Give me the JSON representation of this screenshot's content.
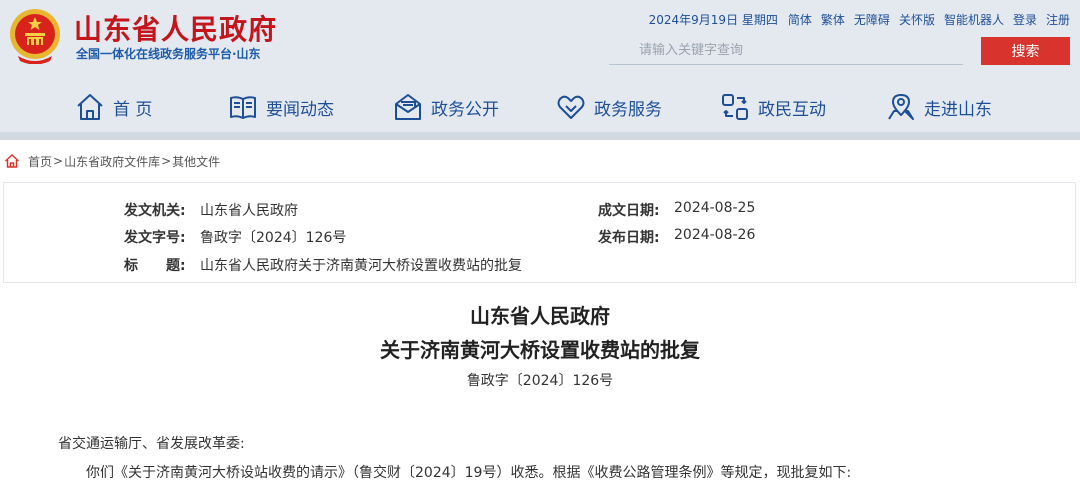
{
  "header": {
    "site_title": "山东省人民政府",
    "site_subtitle": "全国一体化在线政务服务平台·山东",
    "emblem_icon": "national-emblem-icon",
    "toplinks": {
      "date": "2024年9月19日 星期四",
      "simplified": "简体",
      "traditional": "繁体",
      "accessibility": "无障碍",
      "elderly": "关怀版",
      "robot": "智能机器人",
      "login": "登录",
      "register": "注册"
    },
    "search": {
      "placeholder": "请输入关键字查询",
      "button_label": "搜索"
    }
  },
  "nav": {
    "items": [
      {
        "label": "首 页",
        "icon": "home-icon"
      },
      {
        "label": "要闻动态",
        "icon": "book-icon"
      },
      {
        "label": "政务公开",
        "icon": "mail-open-icon"
      },
      {
        "label": "政务服务",
        "icon": "heart-icon"
      },
      {
        "label": "政民互动",
        "icon": "interaction-icon"
      },
      {
        "label": "走进山东",
        "icon": "location-icon"
      }
    ]
  },
  "breadcrumb": {
    "items": [
      "首页",
      "山东省政府文件库",
      "其他文件"
    ],
    "separator": ">"
  },
  "meta": {
    "issuer_label": "发文机关:",
    "issuer": "山东省人民政府",
    "doc_no_label": "发文字号:",
    "doc_no": "鲁政字〔2024〕126号",
    "title_label": "标　　题:",
    "title": "山东省人民政府关于济南黄河大桥设置收费站的批复",
    "created_label": "成文日期:",
    "created": "2024-08-25",
    "published_label": "发布日期:",
    "published": "2024-08-26"
  },
  "document": {
    "title_line1": "山东省人民政府",
    "title_line2": "关于济南黄河大桥设置收费站的批复",
    "doc_number": "鲁政字〔2024〕126号",
    "addressee": "省交通运输厅、省发展改革委:",
    "paragraph1": "你们《关于济南黄河大桥设站收费的请示》（鲁交财〔2024〕19号）收悉。根据《收费公路管理条例》等规定，现批复如下:"
  },
  "colors": {
    "brand_red": "#c3151b",
    "nav_blue": "#1e4f96",
    "search_red": "#d8342d",
    "header_bg": "#e4e9f0"
  }
}
